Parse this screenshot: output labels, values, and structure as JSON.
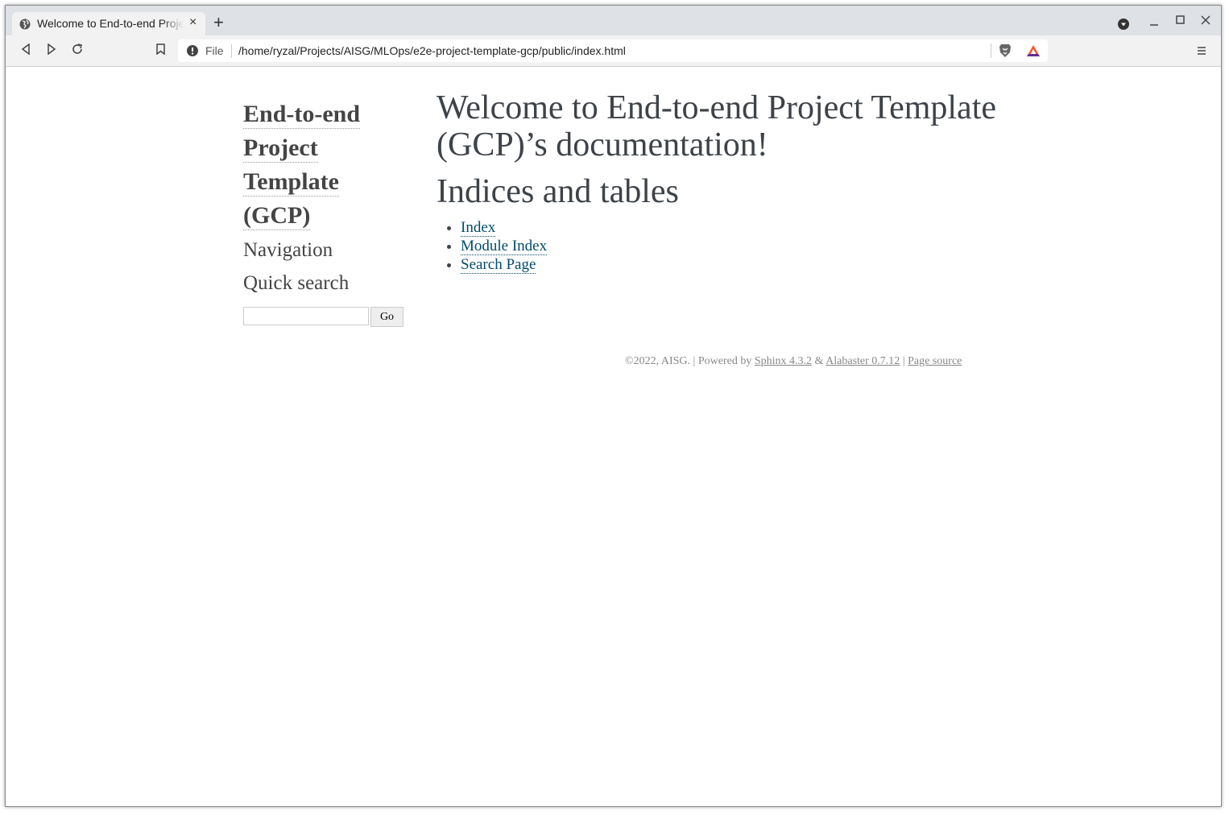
{
  "browser": {
    "tab_title": "Welcome to End-to-end Project Template (GCP)’s documentation!",
    "url_scheme_label": "File",
    "url": "/home/ryzal/Projects/AISG/MLOps/e2e-project-template-gcp/public/index.html",
    "new_tab_label": "+",
    "close_tab_label": "×",
    "brave_accent": "#fb542b"
  },
  "sidebar": {
    "logo_lines": [
      "End-to-end",
      "Project",
      "Template",
      "(GCP)"
    ],
    "navigation_heading": "Navigation",
    "quick_search_heading": "Quick search",
    "search_value": "",
    "go_label": "Go"
  },
  "main": {
    "title": "Welcome to End-to-end Project Template (GCP)’s documentation!",
    "section_heading": "Indices and tables",
    "links": [
      "Index",
      "Module Index",
      "Search Page"
    ],
    "link_color": "#004b6b"
  },
  "footer": {
    "copyright": "©2022, AISG.",
    "sep1": " | Powered by ",
    "sphinx": "Sphinx 4.3.2",
    "amp": " & ",
    "alabaster": "Alabaster 0.7.12",
    "sep2": " | ",
    "page_source": "Page source"
  }
}
